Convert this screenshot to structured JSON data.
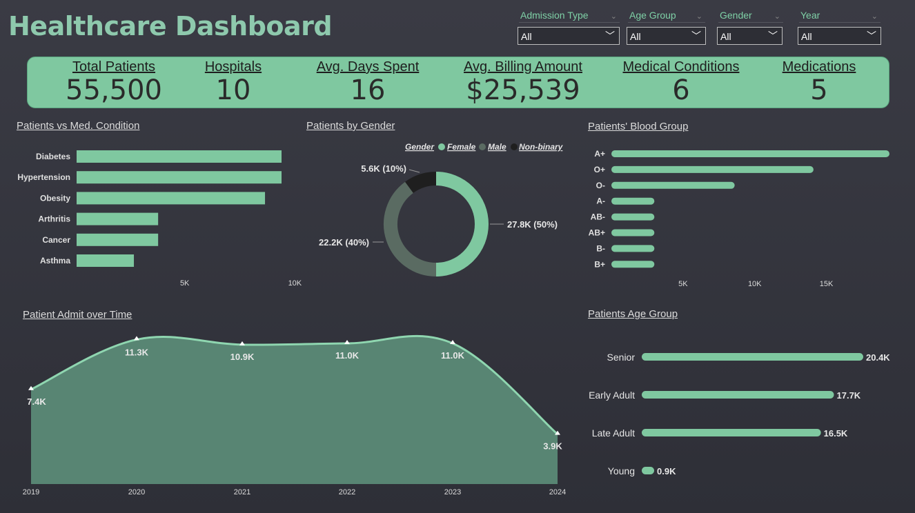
{
  "title": "Healthcare Dashboard",
  "filters": [
    {
      "label": "Admission Type",
      "value": "All"
    },
    {
      "label": "Age Group",
      "value": "All"
    },
    {
      "label": "Gender",
      "value": "All"
    },
    {
      "label": "Year",
      "value": "All"
    }
  ],
  "kpis": [
    {
      "label": "Total Patients",
      "value": "55,500"
    },
    {
      "label": "Hospitals",
      "value": "10"
    },
    {
      "label": "Avg. Days Spent",
      "value": "16"
    },
    {
      "label": "Avg. Billing Amount",
      "value": "$25,539"
    },
    {
      "label": "Medical Conditions",
      "value": "6"
    },
    {
      "label": "Medications",
      "value": "5"
    }
  ],
  "colors": {
    "accent": "#7fc8a0",
    "male": "#5a6b62",
    "nonbinary": "#1f1f1f",
    "area": "#5b8a76"
  },
  "chart_data": [
    {
      "type": "bar",
      "orientation": "horizontal",
      "title": "Patients vs Med. Condition",
      "categories": [
        "Diabetes",
        "Hypertension",
        "Obesity",
        "Arthritis",
        "Cancer",
        "Asthma"
      ],
      "values": [
        9300,
        9300,
        8550,
        3700,
        3700,
        2600
      ],
      "ticks": [
        "5K",
        "10K"
      ],
      "tick_values": [
        5000,
        10000
      ]
    },
    {
      "type": "pie",
      "title": "Patients by Gender",
      "legend_title": "Gender",
      "legend_position": "top",
      "categories": [
        "Female",
        "Male",
        "Non-binary"
      ],
      "values": [
        27800,
        22200,
        5600
      ],
      "labels": [
        "27.8K (50%)",
        "22.2K (40%)",
        "5.6K (10%)"
      ]
    },
    {
      "type": "bar",
      "orientation": "horizontal",
      "title": "Patients' Blood Group",
      "categories": [
        "A+",
        "O+",
        "O-",
        "A-",
        "AB-",
        "AB+",
        "B-",
        "B+"
      ],
      "values": [
        19400,
        14100,
        8600,
        3000,
        3000,
        3000,
        3000,
        3000
      ],
      "ticks": [
        "5K",
        "10K",
        "15K"
      ],
      "tick_values": [
        5000,
        10000,
        15000
      ]
    },
    {
      "type": "area",
      "title": "Patient Admit over Time",
      "x": [
        "2019",
        "2020",
        "2021",
        "2022",
        "2023",
        "2024"
      ],
      "values": [
        7400,
        11300,
        10900,
        11000,
        11000,
        3900
      ],
      "labels": [
        "7.4K",
        "11.3K",
        "10.9K",
        "11.0K",
        "11.0K",
        "3.9K"
      ]
    },
    {
      "type": "bar",
      "orientation": "horizontal",
      "title": "Patients Age Group",
      "categories": [
        "Senior",
        "Early Adult",
        "Late Adult",
        "Young"
      ],
      "values": [
        20400,
        17700,
        16500,
        900
      ],
      "labels": [
        "20.4K",
        "17.7K",
        "16.5K",
        "0.9K"
      ]
    }
  ]
}
